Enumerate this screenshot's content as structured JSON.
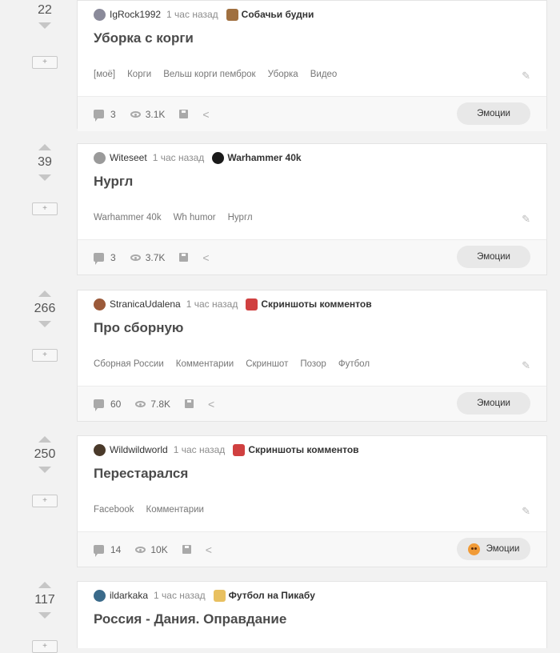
{
  "posts": [
    {
      "rating": "22",
      "author": "IgRock1992",
      "time": "1 час назад",
      "community": "Собачьи будни",
      "title": "Уборка с корги",
      "tags": [
        "[моё]",
        "Корги",
        "Вельш корги пемброк",
        "Уборка",
        "Видео"
      ],
      "comments": "3",
      "views": "3.1K",
      "emotions": "Эмоции"
    },
    {
      "rating": "39",
      "author": "Witeseet",
      "time": "1 час назад",
      "community": "Warhammer 40k",
      "title": "Нургл",
      "tags": [
        "Warhammer 40k",
        "Wh humor",
        "Нургл"
      ],
      "comments": "3",
      "views": "3.7K",
      "emotions": "Эмоции"
    },
    {
      "rating": "266",
      "author": "StranicaUdalena",
      "time": "1 час назад",
      "community": "Скриншоты комментов",
      "title": "Про сборную",
      "tags": [
        "Сборная России",
        "Комментарии",
        "Скриншот",
        "Позор",
        "Футбол"
      ],
      "comments": "60",
      "views": "7.8K",
      "emotions": "Эмоции"
    },
    {
      "rating": "250",
      "author": "Wildwildworld",
      "time": "1 час назад",
      "community": "Скриншоты комментов",
      "title": "Перестарался",
      "tags": [
        "Facebook",
        "Комментарии"
      ],
      "comments": "14",
      "views": "10K",
      "emotions": "Эмоции"
    },
    {
      "rating": "117",
      "author": "ildarkaka",
      "time": "1 час назад",
      "community": "Футбол на Пикабу",
      "title": "Россия - Дания. Оправдание"
    }
  ],
  "colors": {
    "avatar_1": "#8a8a9a",
    "avatar_2": "#9a9a9a",
    "avatar_3": "#9b5a3a",
    "avatar_4": "#4a3a2a",
    "avatar_5": "#3a6a8a",
    "comm_1": "#a07040",
    "comm_2": "#1a1a1a",
    "comm_3": "#d04040",
    "comm_5": "#e8c060",
    "emotion_face": "#f19b37"
  },
  "icons": {
    "vote_up": "triangle-up-icon",
    "vote_down": "triangle-down-icon",
    "comments": "comment-icon",
    "views": "eye-icon",
    "save": "save-icon",
    "share": "share-icon",
    "edit": "pencil-icon",
    "emotion": "emoji-face-icon"
  }
}
